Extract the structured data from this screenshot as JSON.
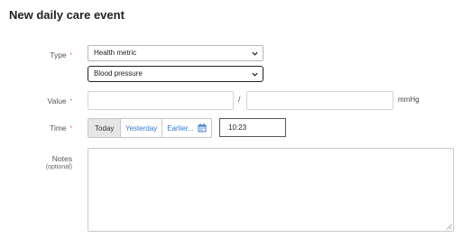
{
  "page": {
    "title": "New daily care event"
  },
  "form": {
    "type": {
      "label": "Type",
      "required_mark": "*",
      "category_value": "Health metric",
      "metric_value": "Blood pressure"
    },
    "value": {
      "label": "Value",
      "required_mark": "*",
      "separator": "/",
      "unit": "mmHg",
      "systolic": "",
      "diastolic": ""
    },
    "time": {
      "label": "Time",
      "required_mark": "*",
      "options": [
        "Today",
        "Yesterday",
        "Earlier..."
      ],
      "selected": "Today",
      "value": "10:23"
    },
    "notes": {
      "label": "Notes",
      "sublabel": "(optional)",
      "value": ""
    }
  },
  "icons": {
    "dropdown": "chevron-down-icon",
    "calendar": "calendar-icon",
    "resize": "resize-grip-icon"
  },
  "colors": {
    "link": "#3a78c8",
    "required": "#cc4444",
    "active_segment": "#e6e6e6"
  }
}
